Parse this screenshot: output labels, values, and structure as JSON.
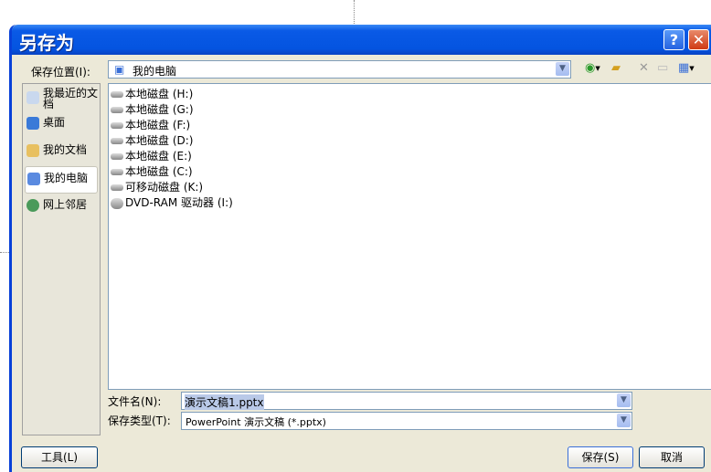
{
  "dialog": {
    "title": "另存为",
    "help_label": "?",
    "close_label": "✕"
  },
  "location": {
    "label": "保存位置(I):",
    "value": "我的电脑"
  },
  "toolbar": {
    "back": "back-icon",
    "up": "up-folder-icon",
    "delete": "delete-icon",
    "new_folder": "new-folder-icon",
    "views": "views-icon"
  },
  "sidebar": {
    "items": [
      {
        "label": "我最近的文档"
      },
      {
        "label": "桌面"
      },
      {
        "label": "我的文档"
      },
      {
        "label": "我的电脑"
      },
      {
        "label": "网上邻居"
      }
    ]
  },
  "files": [
    {
      "label": "本地磁盘 (H:)"
    },
    {
      "label": "本地磁盘 (G:)"
    },
    {
      "label": "本地磁盘 (F:)"
    },
    {
      "label": "本地磁盘 (D:)"
    },
    {
      "label": "本地磁盘 (E:)"
    },
    {
      "label": "本地磁盘 (C:)"
    },
    {
      "label": "可移动磁盘 (K:)"
    },
    {
      "label": "DVD-RAM 驱动器 (I:)"
    }
  ],
  "filename": {
    "label": "文件名(N):",
    "value": "演示文稿1.pptx"
  },
  "filetype": {
    "label": "保存类型(T):",
    "value": "PowerPoint 演示文稿 (*.pptx)"
  },
  "buttons": {
    "tools": "工具(L)",
    "save": "保存(S)",
    "cancel": "取消"
  }
}
